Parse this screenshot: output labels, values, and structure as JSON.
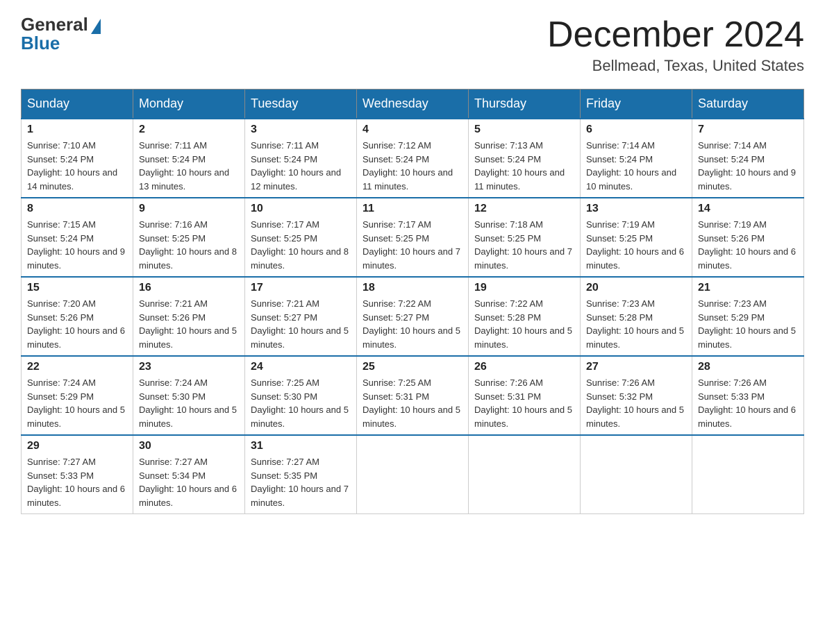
{
  "header": {
    "logo_general": "General",
    "logo_blue": "Blue",
    "month_title": "December 2024",
    "location": "Bellmead, Texas, United States"
  },
  "days_of_week": [
    "Sunday",
    "Monday",
    "Tuesday",
    "Wednesday",
    "Thursday",
    "Friday",
    "Saturday"
  ],
  "weeks": [
    [
      {
        "day": "1",
        "sunrise": "7:10 AM",
        "sunset": "5:24 PM",
        "daylight": "10 hours and 14 minutes."
      },
      {
        "day": "2",
        "sunrise": "7:11 AM",
        "sunset": "5:24 PM",
        "daylight": "10 hours and 13 minutes."
      },
      {
        "day": "3",
        "sunrise": "7:11 AM",
        "sunset": "5:24 PM",
        "daylight": "10 hours and 12 minutes."
      },
      {
        "day": "4",
        "sunrise": "7:12 AM",
        "sunset": "5:24 PM",
        "daylight": "10 hours and 11 minutes."
      },
      {
        "day": "5",
        "sunrise": "7:13 AM",
        "sunset": "5:24 PM",
        "daylight": "10 hours and 11 minutes."
      },
      {
        "day": "6",
        "sunrise": "7:14 AM",
        "sunset": "5:24 PM",
        "daylight": "10 hours and 10 minutes."
      },
      {
        "day": "7",
        "sunrise": "7:14 AM",
        "sunset": "5:24 PM",
        "daylight": "10 hours and 9 minutes."
      }
    ],
    [
      {
        "day": "8",
        "sunrise": "7:15 AM",
        "sunset": "5:24 PM",
        "daylight": "10 hours and 9 minutes."
      },
      {
        "day": "9",
        "sunrise": "7:16 AM",
        "sunset": "5:25 PM",
        "daylight": "10 hours and 8 minutes."
      },
      {
        "day": "10",
        "sunrise": "7:17 AM",
        "sunset": "5:25 PM",
        "daylight": "10 hours and 8 minutes."
      },
      {
        "day": "11",
        "sunrise": "7:17 AM",
        "sunset": "5:25 PM",
        "daylight": "10 hours and 7 minutes."
      },
      {
        "day": "12",
        "sunrise": "7:18 AM",
        "sunset": "5:25 PM",
        "daylight": "10 hours and 7 minutes."
      },
      {
        "day": "13",
        "sunrise": "7:19 AM",
        "sunset": "5:25 PM",
        "daylight": "10 hours and 6 minutes."
      },
      {
        "day": "14",
        "sunrise": "7:19 AM",
        "sunset": "5:26 PM",
        "daylight": "10 hours and 6 minutes."
      }
    ],
    [
      {
        "day": "15",
        "sunrise": "7:20 AM",
        "sunset": "5:26 PM",
        "daylight": "10 hours and 6 minutes."
      },
      {
        "day": "16",
        "sunrise": "7:21 AM",
        "sunset": "5:26 PM",
        "daylight": "10 hours and 5 minutes."
      },
      {
        "day": "17",
        "sunrise": "7:21 AM",
        "sunset": "5:27 PM",
        "daylight": "10 hours and 5 minutes."
      },
      {
        "day": "18",
        "sunrise": "7:22 AM",
        "sunset": "5:27 PM",
        "daylight": "10 hours and 5 minutes."
      },
      {
        "day": "19",
        "sunrise": "7:22 AM",
        "sunset": "5:28 PM",
        "daylight": "10 hours and 5 minutes."
      },
      {
        "day": "20",
        "sunrise": "7:23 AM",
        "sunset": "5:28 PM",
        "daylight": "10 hours and 5 minutes."
      },
      {
        "day": "21",
        "sunrise": "7:23 AM",
        "sunset": "5:29 PM",
        "daylight": "10 hours and 5 minutes."
      }
    ],
    [
      {
        "day": "22",
        "sunrise": "7:24 AM",
        "sunset": "5:29 PM",
        "daylight": "10 hours and 5 minutes."
      },
      {
        "day": "23",
        "sunrise": "7:24 AM",
        "sunset": "5:30 PM",
        "daylight": "10 hours and 5 minutes."
      },
      {
        "day": "24",
        "sunrise": "7:25 AM",
        "sunset": "5:30 PM",
        "daylight": "10 hours and 5 minutes."
      },
      {
        "day": "25",
        "sunrise": "7:25 AM",
        "sunset": "5:31 PM",
        "daylight": "10 hours and 5 minutes."
      },
      {
        "day": "26",
        "sunrise": "7:26 AM",
        "sunset": "5:31 PM",
        "daylight": "10 hours and 5 minutes."
      },
      {
        "day": "27",
        "sunrise": "7:26 AM",
        "sunset": "5:32 PM",
        "daylight": "10 hours and 5 minutes."
      },
      {
        "day": "28",
        "sunrise": "7:26 AM",
        "sunset": "5:33 PM",
        "daylight": "10 hours and 6 minutes."
      }
    ],
    [
      {
        "day": "29",
        "sunrise": "7:27 AM",
        "sunset": "5:33 PM",
        "daylight": "10 hours and 6 minutes."
      },
      {
        "day": "30",
        "sunrise": "7:27 AM",
        "sunset": "5:34 PM",
        "daylight": "10 hours and 6 minutes."
      },
      {
        "day": "31",
        "sunrise": "7:27 AM",
        "sunset": "5:35 PM",
        "daylight": "10 hours and 7 minutes."
      },
      null,
      null,
      null,
      null
    ]
  ],
  "labels": {
    "sunrise": "Sunrise:",
    "sunset": "Sunset:",
    "daylight": "Daylight:"
  }
}
